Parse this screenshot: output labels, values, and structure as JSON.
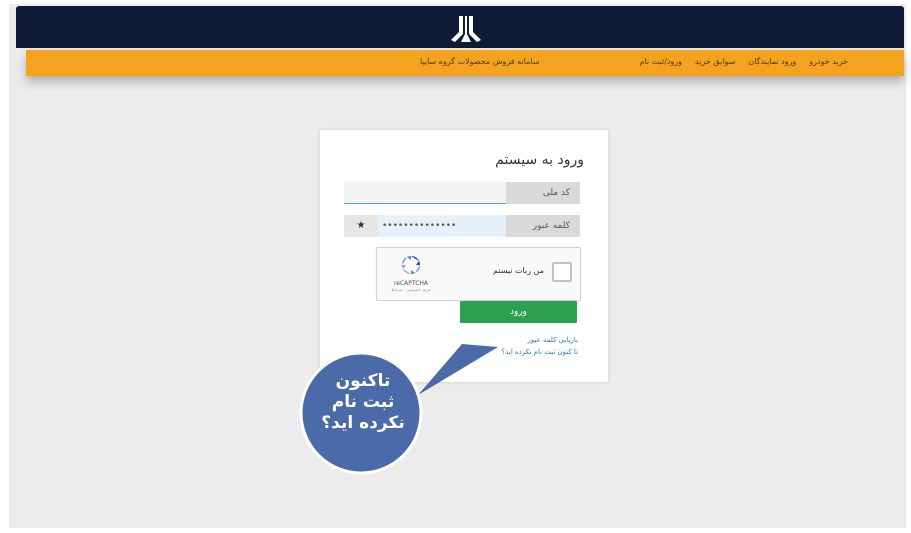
{
  "header": {
    "site_title": "سامانه فروش محصولات گروه سایپا",
    "nav": [
      {
        "label": "خرید خودرو"
      },
      {
        "label": "ورود نمایندگان"
      },
      {
        "label": "سوابق خرید"
      },
      {
        "label": "ورود/ثبت نام"
      }
    ],
    "logo_icon": "saipa-logo-icon"
  },
  "login": {
    "title": "ورود به سیستم",
    "national_id_label": "کد ملی",
    "national_id_value": "",
    "password_label": "کلمه عبور",
    "password_value": "••••••••••••••",
    "show_password_icon": "★",
    "captcha": {
      "text": "من ربات نیستم",
      "brand": "reCAPTCHA",
      "terms": "حریم خصوصی - شرایط"
    },
    "submit_label": "ورود",
    "forgot_label": "بازیابی کلمه عبور",
    "register_label": "تا کنون ثبت نام نکرده اید؟"
  },
  "callout": {
    "lines": [
      "تاکنون",
      "ثبت نام",
      "نکرده اید؟"
    ],
    "color": "#4a6aa8"
  },
  "colors": {
    "header_bg": "#0f1a36",
    "nav_bg": "#f5a21f",
    "login_button": "#2e9e4f"
  }
}
